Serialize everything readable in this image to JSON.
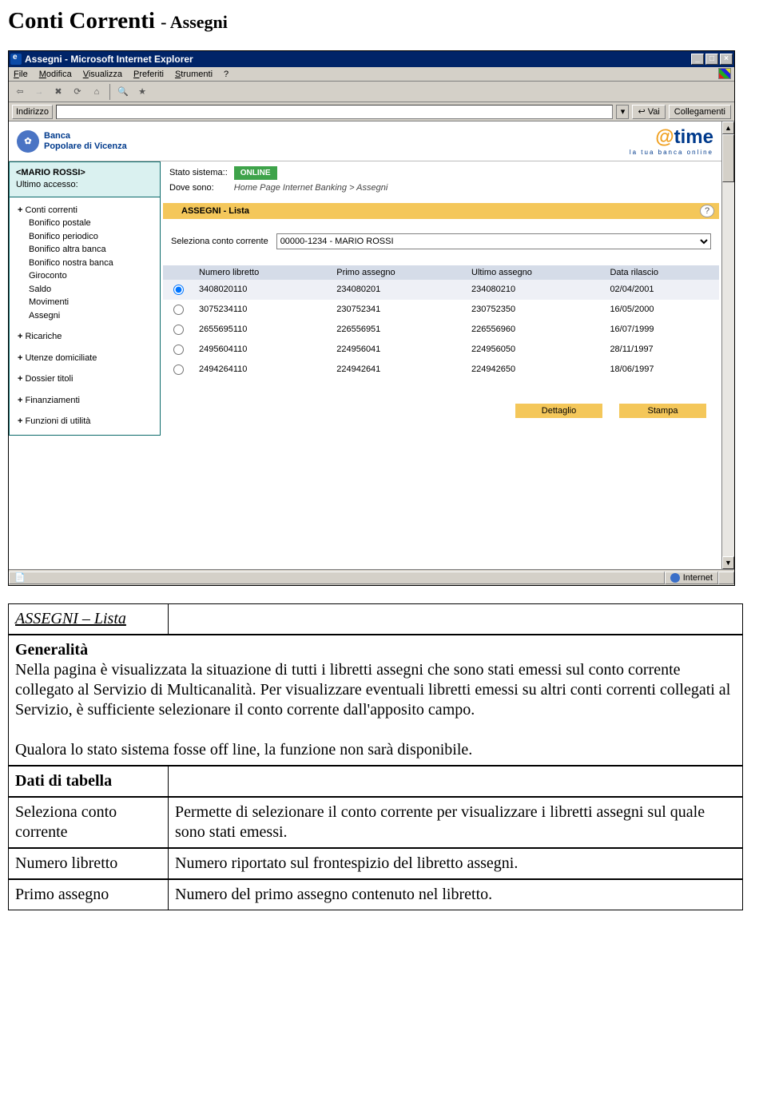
{
  "doc": {
    "title_main": "Conti Correnti",
    "title_sub": "- Assegni"
  },
  "window": {
    "title": "Assegni - Microsoft Internet Explorer",
    "menu": [
      "File",
      "Modifica",
      "Visualizza",
      "Preferiti",
      "Strumenti",
      "?"
    ],
    "address_label": "Indirizzo",
    "go_label": "Vai",
    "links_label": "Collegamenti"
  },
  "brand": {
    "bank_line1": "Banca",
    "bank_line2": "Popolare di Vicenza",
    "product": "time",
    "tagline": "la tua banca online"
  },
  "user": {
    "name": "<MARIO ROSSI>",
    "last_access_label": "Ultimo accesso:"
  },
  "nav": {
    "groups": [
      {
        "plus": true,
        "label": "Conti correnti"
      },
      {
        "plus": false,
        "label": "Bonifico postale"
      },
      {
        "plus": false,
        "label": "Bonifico periodico"
      },
      {
        "plus": false,
        "label": "Bonifico altra banca"
      },
      {
        "plus": false,
        "label": "Bonifico nostra banca"
      },
      {
        "plus": false,
        "label": "Giroconto"
      },
      {
        "plus": false,
        "label": "Saldo"
      },
      {
        "plus": false,
        "label": "Movimenti"
      },
      {
        "plus": false,
        "label": "Assegni"
      },
      {
        "plus": true,
        "label": "Ricariche"
      },
      {
        "plus": true,
        "label": "Utenze domiciliate"
      },
      {
        "plus": true,
        "label": "Dossier titoli"
      },
      {
        "plus": true,
        "label": "Finanziamenti"
      },
      {
        "plus": true,
        "label": "Funzioni di utilità"
      }
    ]
  },
  "status": {
    "system_label": "Stato sistema::",
    "system_value": "ONLINE",
    "where_label": "Dove sono:",
    "breadcrumb": "Home Page Internet Banking > Assegni"
  },
  "section": {
    "tab": " ",
    "title": "ASSEGNI - Lista",
    "select_label": "Seleziona conto corrente",
    "select_value": "00000-1234 - MARIO ROSSI"
  },
  "table": {
    "headers": [
      "Numero libretto",
      "Primo assegno",
      "Ultimo assegno",
      "Data rilascio"
    ],
    "rows": [
      {
        "checked": true,
        "cols": [
          "3408020110",
          "234080201",
          "234080210",
          "02/04/2001"
        ]
      },
      {
        "checked": false,
        "cols": [
          "3075234110",
          "230752341",
          "230752350",
          "16/05/2000"
        ]
      },
      {
        "checked": false,
        "cols": [
          "2655695110",
          "226556951",
          "226556960",
          "16/07/1999"
        ]
      },
      {
        "checked": false,
        "cols": [
          "2495604110",
          "224956041",
          "224956050",
          "28/11/1997"
        ]
      },
      {
        "checked": false,
        "cols": [
          "2494264110",
          "224942641",
          "224942650",
          "18/06/1997"
        ]
      }
    ]
  },
  "actions": {
    "detail": "Dettaglio",
    "print": "Stampa"
  },
  "statusbar": {
    "zone": "Internet"
  },
  "desc": {
    "section_title": "ASSEGNI – Lista",
    "generalita_h": "Generalità",
    "generalita_p1": "Nella pagina è visualizzata la situazione di tutti i libretti assegni che sono stati emessi sul conto corrente collegato al Servizio di Multicanalità. Per visualizzare eventuali libretti emessi su altri conti correnti collegati al Servizio, è sufficiente selezionare il conto corrente dall'apposito campo.",
    "generalita_p2": "Qualora lo stato sistema fosse off line, la funzione non sarà disponibile.",
    "dati_h": "Dati di tabella",
    "row1_l": "Seleziona conto corrente",
    "row1_r": "Permette di selezionare il conto corrente per visualizzare i libretti assegni sul quale sono stati emessi.",
    "row2_l": "Numero libretto",
    "row2_r": "Numero riportato sul frontespizio del libretto assegni.",
    "row3_l": "Primo assegno",
    "row3_r": "Numero del primo assegno contenuto nel libretto."
  }
}
